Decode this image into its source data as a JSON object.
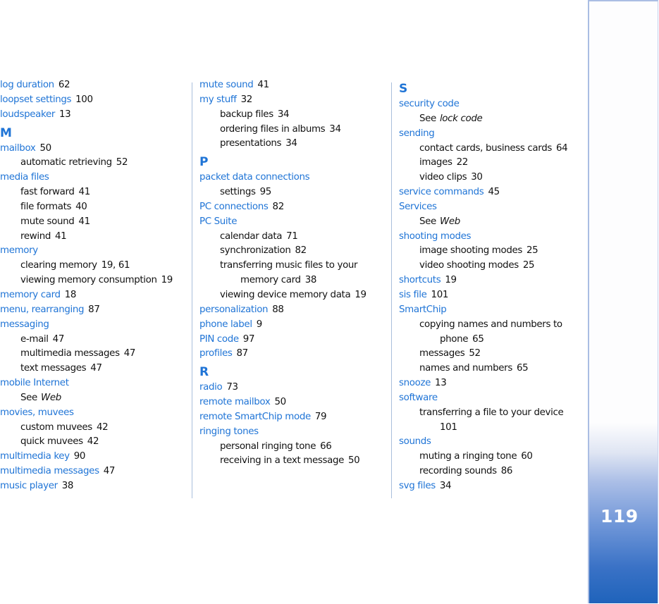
{
  "page_number": "119",
  "see_word": "See",
  "columns": [
    {
      "entries": [
        {
          "level": 0,
          "term": "log duration",
          "pages": "62"
        },
        {
          "level": 0,
          "term": "loopset settings",
          "pages": "100"
        },
        {
          "level": 0,
          "term": "loudspeaker",
          "pages": "13"
        },
        {
          "level": "letter",
          "term": "M"
        },
        {
          "level": 0,
          "term": "mailbox",
          "pages": "50"
        },
        {
          "level": 1,
          "term": "automatic retrieving",
          "pages": "52"
        },
        {
          "level": 0,
          "term": "media files",
          "pages": ""
        },
        {
          "level": 1,
          "term": "fast forward",
          "pages": "41"
        },
        {
          "level": 1,
          "term": "file formats",
          "pages": "40"
        },
        {
          "level": 1,
          "term": "mute sound",
          "pages": "41"
        },
        {
          "level": 1,
          "term": "rewind",
          "pages": "41"
        },
        {
          "level": 0,
          "term": "memory",
          "pages": ""
        },
        {
          "level": 1,
          "term": "clearing memory",
          "pages": "19, 61"
        },
        {
          "level": 1,
          "term": "viewing memory consumption",
          "pages": "19"
        },
        {
          "level": 0,
          "term": "memory card",
          "pages": "18"
        },
        {
          "level": 0,
          "term": "menu, rearranging",
          "pages": "87"
        },
        {
          "level": 0,
          "term": "messaging",
          "pages": ""
        },
        {
          "level": 1,
          "term": "e-mail",
          "pages": "47"
        },
        {
          "level": 1,
          "term": "multimedia messages",
          "pages": "47"
        },
        {
          "level": 1,
          "term": "text messages",
          "pages": "47"
        },
        {
          "level": 0,
          "term": "mobile Internet",
          "pages": ""
        },
        {
          "level": "see",
          "term": "Web"
        },
        {
          "level": 0,
          "term": "movies, muvees",
          "pages": ""
        },
        {
          "level": 1,
          "term": "custom muvees",
          "pages": "42"
        },
        {
          "level": 1,
          "term": "quick muvees",
          "pages": "42"
        },
        {
          "level": 0,
          "term": "multimedia key",
          "pages": "90"
        },
        {
          "level": 0,
          "term": "multimedia messages",
          "pages": "47"
        },
        {
          "level": 0,
          "term": "music player",
          "pages": "38"
        }
      ]
    },
    {
      "entries": [
        {
          "level": 0,
          "term": "mute sound",
          "pages": "41"
        },
        {
          "level": 0,
          "term": "my stuff",
          "pages": "32"
        },
        {
          "level": 1,
          "term": "backup files",
          "pages": "34"
        },
        {
          "level": 1,
          "term": "ordering files in albums",
          "pages": "34"
        },
        {
          "level": 1,
          "term": "presentations",
          "pages": "34"
        },
        {
          "level": "letter",
          "term": "P"
        },
        {
          "level": 0,
          "term": "packet data connections",
          "pages": ""
        },
        {
          "level": 1,
          "term": "settings",
          "pages": "95"
        },
        {
          "level": 0,
          "term": "PC connections",
          "pages": "82"
        },
        {
          "level": 0,
          "term": "PC Suite",
          "pages": ""
        },
        {
          "level": 1,
          "term": "calendar data",
          "pages": "71"
        },
        {
          "level": 1,
          "term": "synchronization",
          "pages": "82"
        },
        {
          "level": 1,
          "term": "transferring music files to your",
          "pages": ""
        },
        {
          "level": 2,
          "term": "memory card",
          "pages": "38"
        },
        {
          "level": 1,
          "term": "viewing device memory data",
          "pages": "19"
        },
        {
          "level": 0,
          "term": "personalization",
          "pages": "88"
        },
        {
          "level": 0,
          "term": "phone label",
          "pages": "9"
        },
        {
          "level": 0,
          "term": "PIN code",
          "pages": "97"
        },
        {
          "level": 0,
          "term": "profiles",
          "pages": "87"
        },
        {
          "level": "letter",
          "term": "R"
        },
        {
          "level": 0,
          "term": "radio",
          "pages": "73"
        },
        {
          "level": 0,
          "term": "remote mailbox",
          "pages": "50"
        },
        {
          "level": 0,
          "term": "remote SmartChip mode",
          "pages": "79"
        },
        {
          "level": 0,
          "term": "ringing tones",
          "pages": ""
        },
        {
          "level": 1,
          "term": "personal ringing tone",
          "pages": "66"
        },
        {
          "level": 1,
          "term": "receiving in a text message",
          "pages": "50"
        }
      ]
    },
    {
      "entries": [
        {
          "level": "letter",
          "term": "S"
        },
        {
          "level": 0,
          "term": "security code",
          "pages": ""
        },
        {
          "level": "see",
          "term": "lock code"
        },
        {
          "level": 0,
          "term": "sending",
          "pages": ""
        },
        {
          "level": 1,
          "term": "contact cards, business cards",
          "pages": "64"
        },
        {
          "level": 1,
          "term": "images",
          "pages": "22"
        },
        {
          "level": 1,
          "term": "video clips",
          "pages": "30"
        },
        {
          "level": 0,
          "term": "service commands",
          "pages": "45"
        },
        {
          "level": 0,
          "term": "Services",
          "pages": ""
        },
        {
          "level": "see",
          "term": "Web"
        },
        {
          "level": 0,
          "term": "shooting modes",
          "pages": ""
        },
        {
          "level": 1,
          "term": "image shooting modes",
          "pages": "25"
        },
        {
          "level": 1,
          "term": "video shooting modes",
          "pages": "25"
        },
        {
          "level": 0,
          "term": "shortcuts",
          "pages": "19"
        },
        {
          "level": 0,
          "term": "sis file",
          "pages": "101"
        },
        {
          "level": 0,
          "term": "SmartChip",
          "pages": ""
        },
        {
          "level": 1,
          "term": "copying names and numbers to",
          "pages": ""
        },
        {
          "level": 2,
          "term": "phone",
          "pages": "65"
        },
        {
          "level": 1,
          "term": "messages",
          "pages": "52"
        },
        {
          "level": 1,
          "term": "names and numbers",
          "pages": "65"
        },
        {
          "level": 0,
          "term": "snooze",
          "pages": "13"
        },
        {
          "level": 0,
          "term": "software",
          "pages": ""
        },
        {
          "level": 1,
          "term": "transferring a file to your device",
          "pages": ""
        },
        {
          "level": 2,
          "term": "",
          "pages": "101"
        },
        {
          "level": 0,
          "term": "sounds",
          "pages": ""
        },
        {
          "level": 1,
          "term": "muting a ringing tone",
          "pages": "60"
        },
        {
          "level": 1,
          "term": "recording sounds",
          "pages": "86"
        },
        {
          "level": 0,
          "term": "svg files",
          "pages": "34"
        }
      ]
    }
  ],
  "colors": {
    "term": "#1f74d6",
    "text": "#111111",
    "divider": "#a9bfdc",
    "tab_dark": "#1f63bb"
  }
}
